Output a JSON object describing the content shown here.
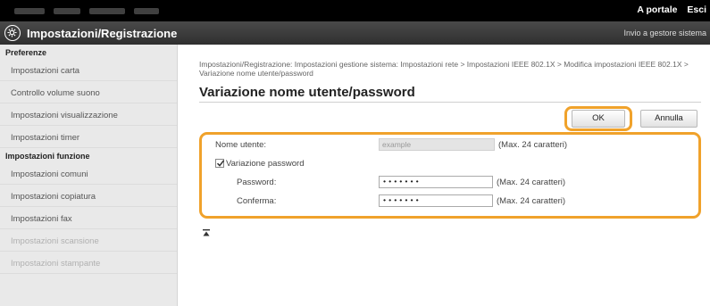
{
  "topbar": {
    "portal_link": "A portale",
    "exit_link": "Esci"
  },
  "header": {
    "title": "Impostazioni/Registrazione",
    "right_link": "Invio a gestore sistema"
  },
  "sidebar": {
    "section1": "Preferenze",
    "items1": [
      "Impostazioni carta",
      "Controllo volume suono",
      "Impostazioni visualizzazione",
      "Impostazioni timer"
    ],
    "section2": "Impostazioni funzione",
    "items2": [
      "Impostazioni comuni",
      "Impostazioni copiatura",
      "Impostazioni fax",
      "Impostazioni scansione",
      "Impostazioni stampante"
    ]
  },
  "main": {
    "breadcrumb": "Impostazioni/Registrazione: Impostazioni gestione sistema: Impostazioni rete > Impostazioni IEEE 802.1X > Modifica impostazioni IEEE 802.1X > Variazione nome utente/password",
    "page_title": "Variazione nome utente/password",
    "ok_label": "OK",
    "cancel_label": "Annulla",
    "username_label": "Nome utente:",
    "username_value": "example",
    "username_note": "(Max. 24 caratteri)",
    "change_password_label": "Variazione password",
    "change_password_checked": true,
    "password_label": "Password:",
    "password_value": "•••••••",
    "password_note": "(Max. 24 caratteri)",
    "confirm_label": "Conferma:",
    "confirm_value": "•••••••",
    "confirm_note": "(Max. 24 caratteri)"
  },
  "colors": {
    "highlight": "#f0a22b",
    "header_bg": "#3a3a3a",
    "sidebar_bg": "#e9e9e9"
  },
  "icons": {
    "app_logo": "settings-gear-icon",
    "back_to_top": "arrow-up-to-top-icon"
  }
}
